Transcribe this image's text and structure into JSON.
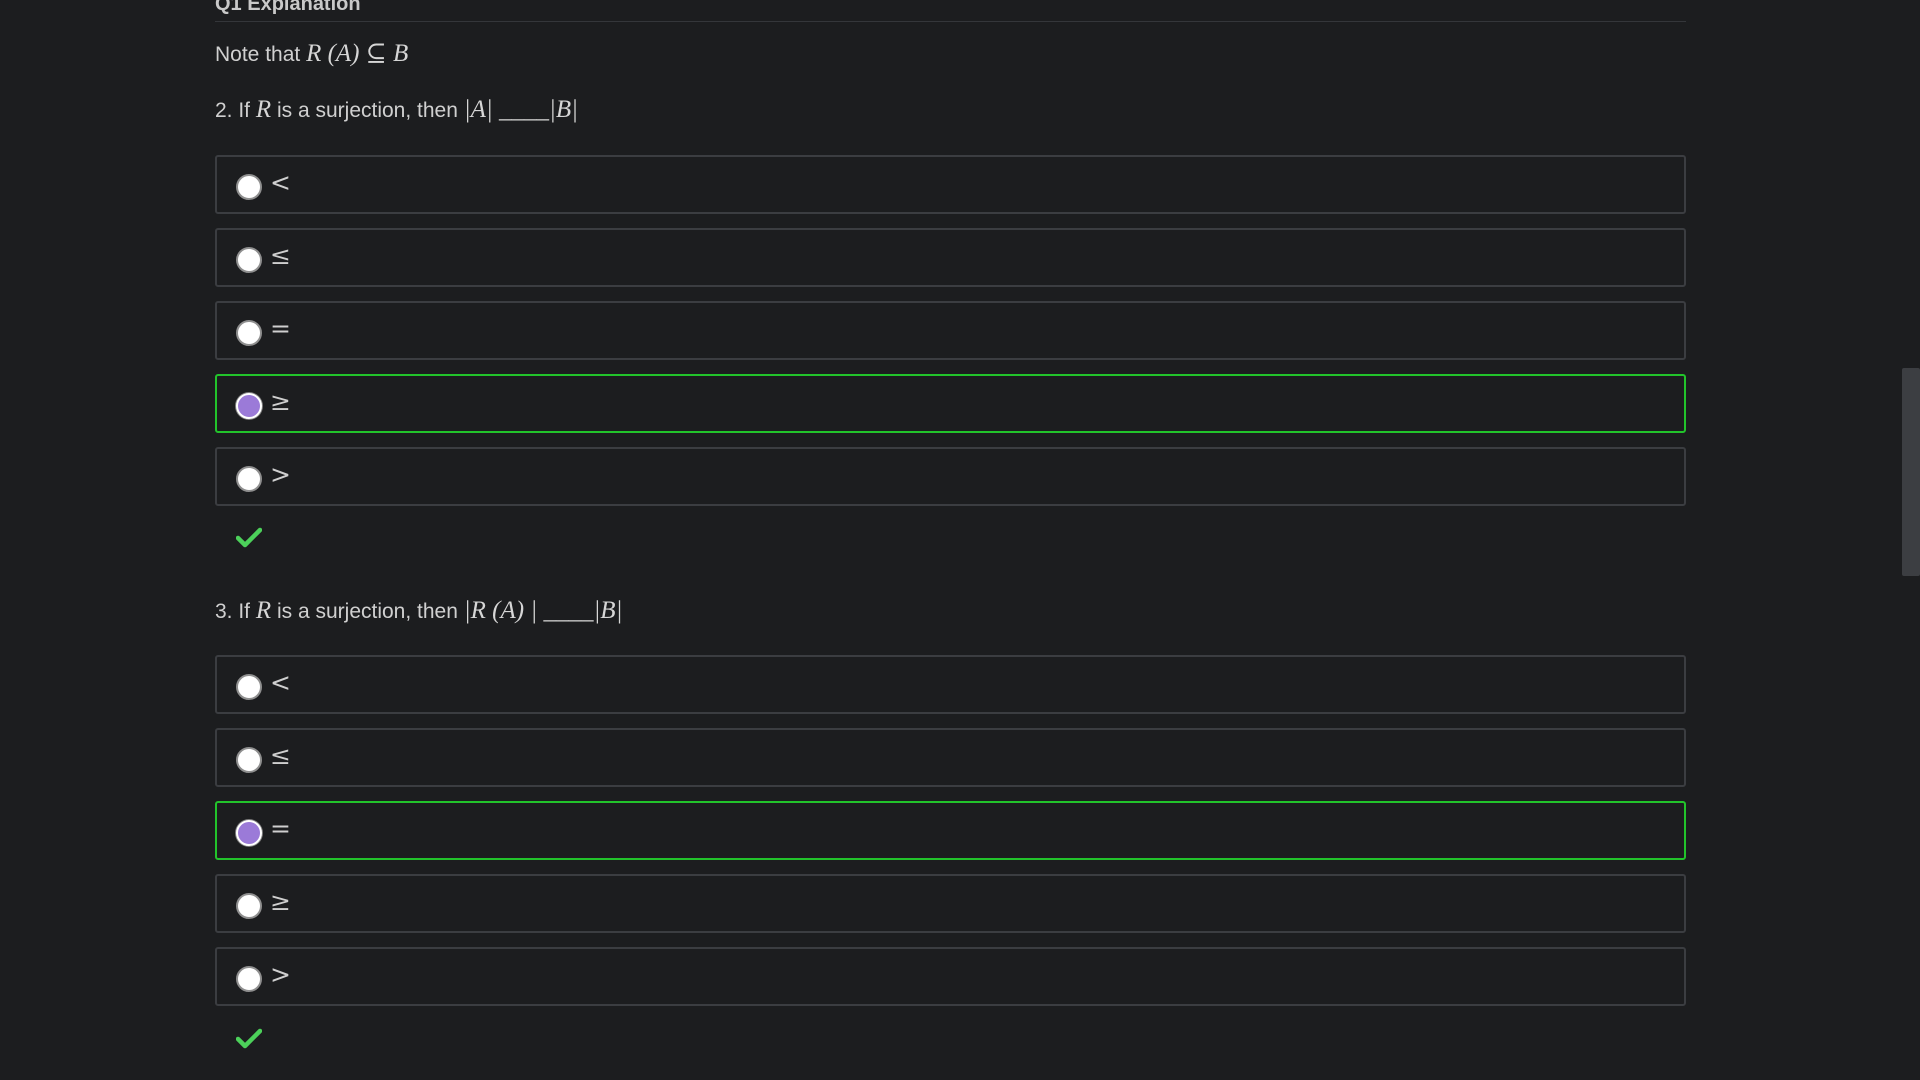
{
  "section": {
    "title": "Q1 Explanation",
    "note_prefix": "Note that ",
    "note_math": "R (A) ⊆ B"
  },
  "questions": [
    {
      "prompt_prefix": "2. If ",
      "var": "R",
      "prompt_mid": " is a surjection, then ",
      "math": "|A| ____|B|",
      "options": [
        "<",
        "≤",
        "=",
        "≥",
        ">"
      ],
      "selected_index": 3,
      "result": "correct"
    },
    {
      "prompt_prefix": "3. If ",
      "var": "R",
      "prompt_mid": " is a surjection, then ",
      "math": "|R (A) | ____|B|",
      "options": [
        "<",
        "≤",
        "=",
        "≥",
        ">"
      ],
      "selected_index": 2,
      "result": "correct"
    }
  ],
  "colors": {
    "background": "#1c1d1f",
    "option_border": "#3b3d41",
    "selected_border": "#22c32b",
    "radio_checked": "#9b7ad8",
    "checkmark": "#4cd05a"
  },
  "icons": {
    "radio": "radio-button-icon",
    "check": "checkmark-icon"
  }
}
